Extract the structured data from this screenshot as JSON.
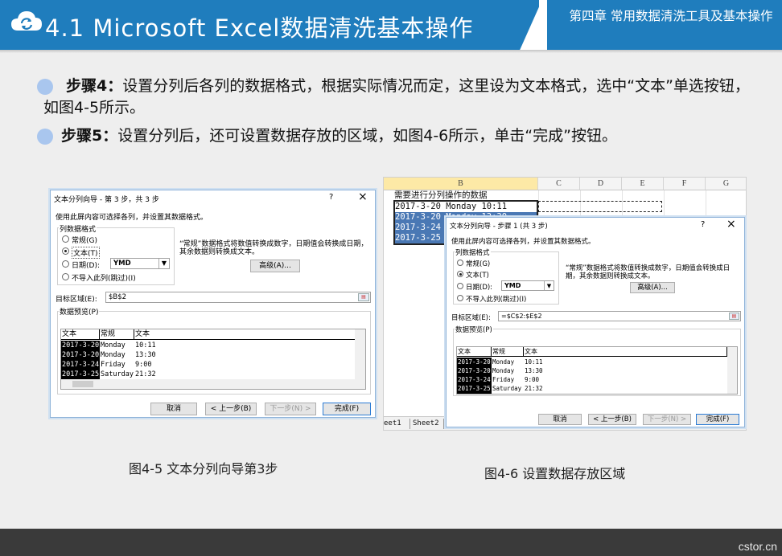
{
  "header": {
    "title": "4.1 Microsoft Excel数据清洗基本操作",
    "chapter": "第四章 常用数据清洗工具及基本操作",
    "accent": "#1f7dbd"
  },
  "steps": [
    {
      "label": "步骤4：",
      "text": "设置分列后各列的数据格式，根据实际情况而定，这里设为文本格式，选中“文本”单选按钮，如图4-5所示。"
    },
    {
      "label": "步骤5：",
      "text": "设置分列后，还可设置数据存放的区域，如图4-6所示，单击“完成”按钮。"
    }
  ],
  "dialog1": {
    "title": "文本分列向导 - 第 3 步，共 3 步",
    "help": "?",
    "close": "×",
    "instruction": "使用此屏内容可选择各列，并设置其数据格式。",
    "group_label": "列数据格式",
    "options": [
      "常规(G)",
      "文本(T)",
      "日期(D):",
      "不导入此列(跳过)(I)"
    ],
    "selected_option": "文本(T)",
    "date_format": "YMD",
    "note": "“常规”数据格式将数值转换成数字，日期值会转换成日期，其余数据则转换成文本。",
    "advanced_button": "高级(A)...",
    "target_label": "目标区域(E):",
    "target_value": "$B$2",
    "preview_label": "数据预览(P)",
    "preview_headers": [
      "文本",
      "常规",
      "文本"
    ],
    "preview_rows": [
      [
        "2017-3-20",
        "Monday",
        "10:11"
      ],
      [
        "2017-3-20",
        "Monday",
        "13:30"
      ],
      [
        "2017-3-24",
        "Friday",
        "9:00"
      ],
      [
        "2017-3-25",
        "Saturday",
        "21:32"
      ]
    ],
    "buttons": {
      "cancel": "取消",
      "back": "< 上一步(B)",
      "next": "下一步(N) >",
      "finish": "完成(F)"
    }
  },
  "spreadsheet": {
    "columns": [
      "B",
      "C",
      "D",
      "E",
      "F",
      "G"
    ],
    "header_cell": "需要进行分列操作的数据",
    "rows": [
      "2017-3-20 Monday 10:11",
      "2017-3-20 Monday 13:30",
      "2017-3-24 Friday 9:00",
      "2017-3-25 Saturday 21:32"
    ],
    "sheet_tabs": [
      "eet1",
      "Sheet2",
      "S"
    ]
  },
  "dialog2": {
    "title": "文本分列向导 - 步骤 1 (共 3 步)",
    "help": "?",
    "close": "×",
    "instruction": "使用此屏内容可选择各列，并设置其数据格式。",
    "group_label": "列数据格式",
    "options": [
      "常规(G)",
      "文本(T)",
      "日期(D):",
      "不导入此列(跳过)(I)"
    ],
    "selected_option": "文本(T)",
    "date_format": "YMD",
    "note": "“常规”数据格式将数值转换成数字，日期值会转换成日期，其余数据则转换成文本。",
    "advanced_button": "高级(A)...",
    "target_label": "目标区域(E):",
    "target_value": "=$C$2:$E$2",
    "preview_label": "数据预览(P)",
    "preview_headers": [
      "文本",
      "常规",
      "文本"
    ],
    "preview_rows": [
      [
        "2017-3-20",
        "Monday",
        "10:11"
      ],
      [
        "2017-3-20",
        "Monday",
        "13:30"
      ],
      [
        "2017-3-24",
        "Friday",
        "9:00"
      ],
      [
        "2017-3-25",
        "Saturday",
        "21:32"
      ]
    ],
    "buttons": {
      "cancel": "取消",
      "back": "< 上一步(B)",
      "next": "下一步(N) >",
      "finish": "完成(F)"
    }
  },
  "captions": {
    "fig1": "图4-5  文本分列向导第3步",
    "fig2": "图4-6  设置数据存放区域"
  },
  "footer": {
    "site": "cstor.cn"
  }
}
